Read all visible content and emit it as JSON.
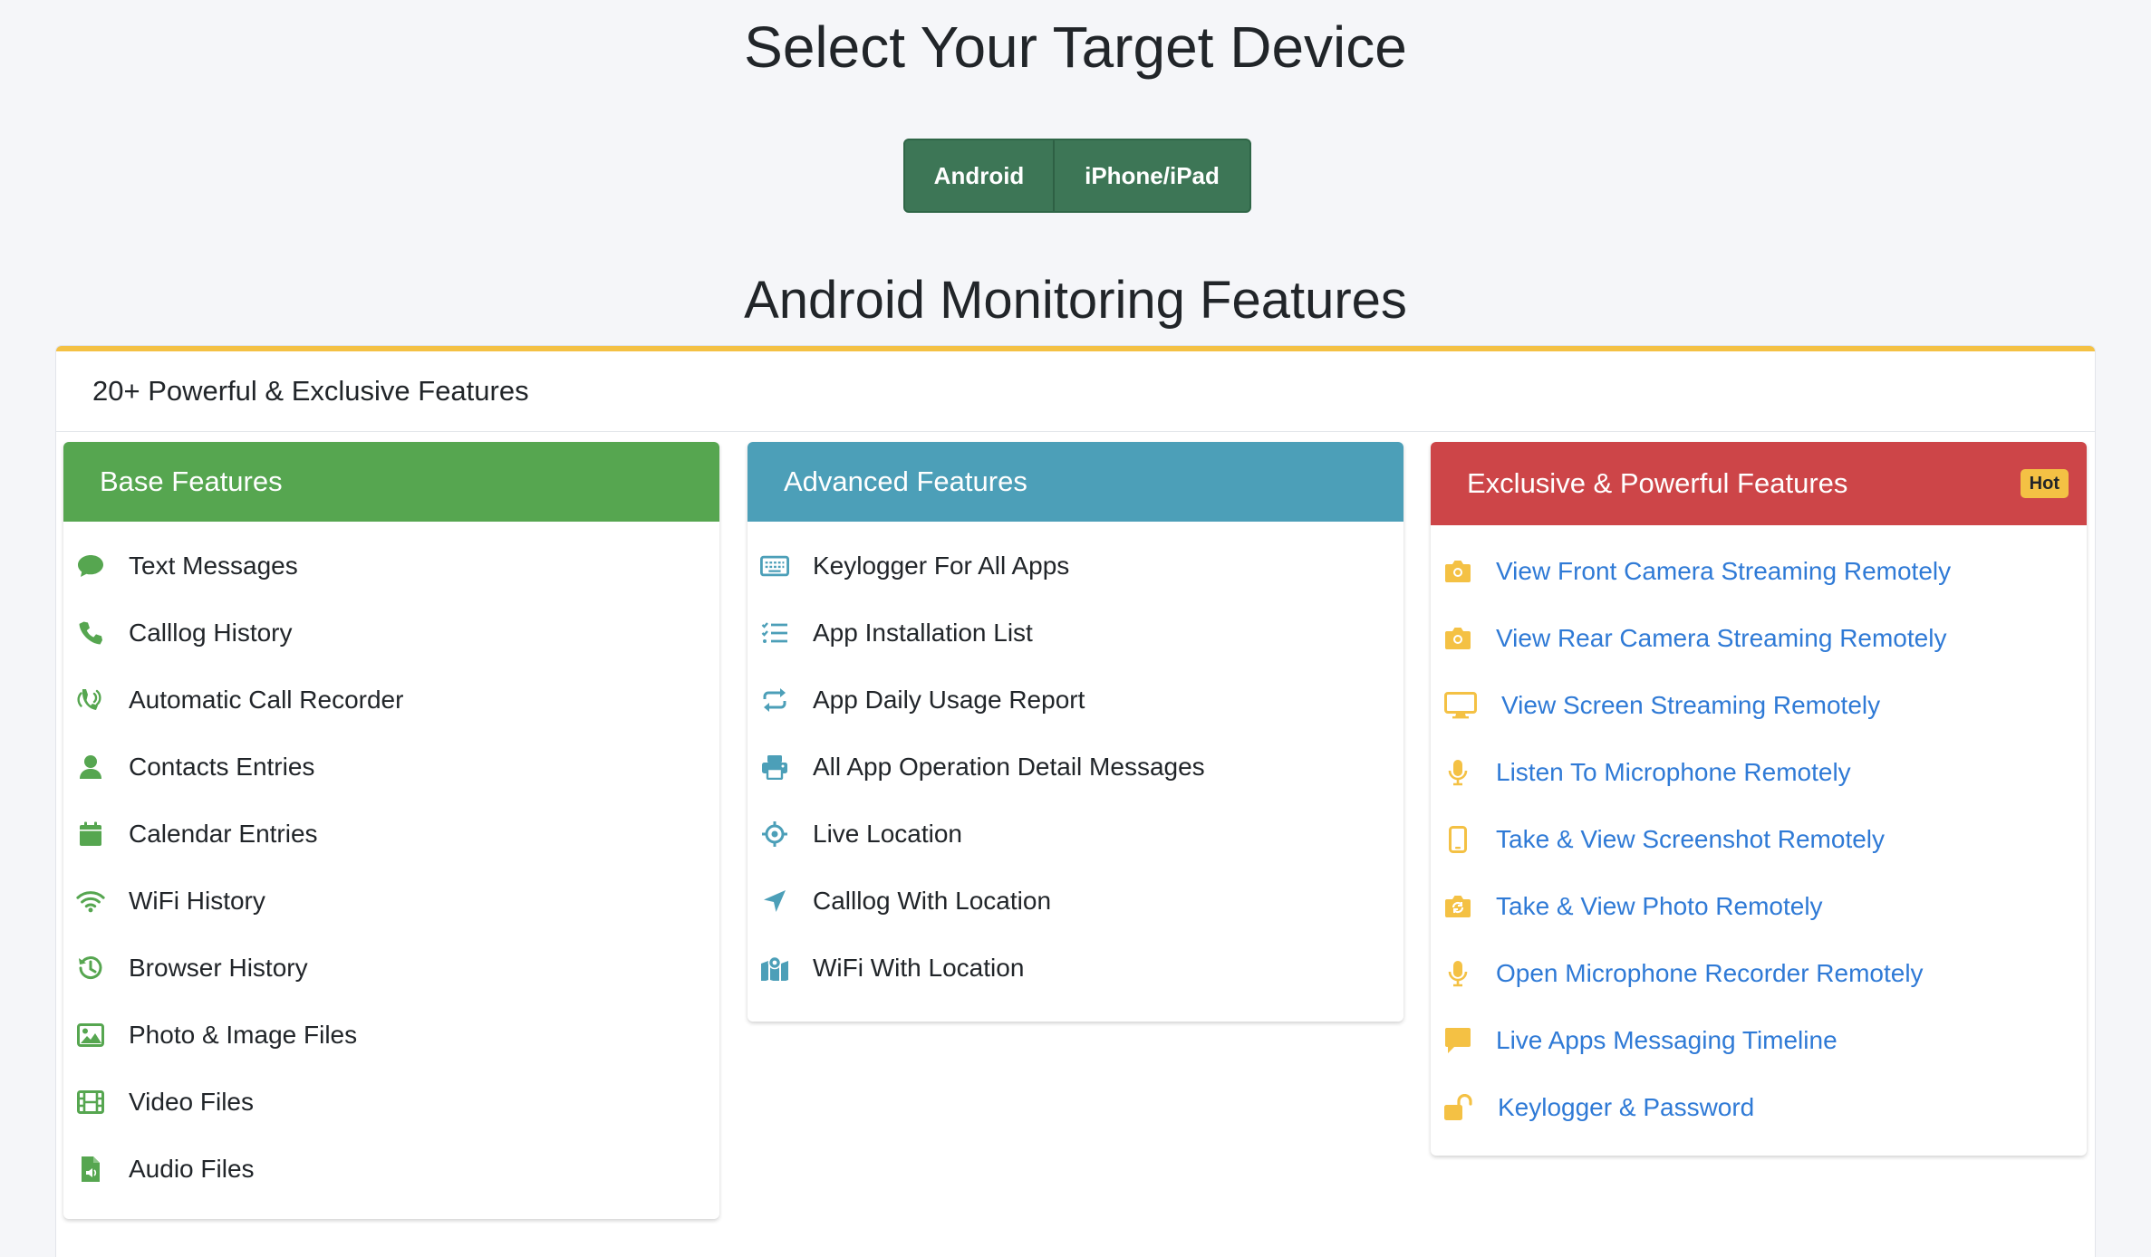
{
  "header": {
    "title": "Select Your Target Device"
  },
  "device_toggle": {
    "android_label": "Android",
    "iphone_label": "iPhone/iPad"
  },
  "section": {
    "title": "Android Monitoring Features",
    "subtitle": "20+ Powerful & Exclusive Features"
  },
  "colors": {
    "accent_yellow": "#f4c144",
    "toggle_green": "#3d7656",
    "base_green": "#56a650",
    "advanced_teal": "#4c9fb8",
    "exclusive_red": "#cd4548",
    "link_blue": "#2f7ad6"
  },
  "base": {
    "title": "Base Features",
    "items": [
      {
        "label": "Text Messages",
        "icon": "chat-bubble-icon"
      },
      {
        "label": "Calllog History",
        "icon": "phone-icon"
      },
      {
        "label": "Automatic Call Recorder",
        "icon": "phone-volume-icon"
      },
      {
        "label": "Contacts Entries",
        "icon": "user-icon"
      },
      {
        "label": "Calendar Entries",
        "icon": "calendar-icon"
      },
      {
        "label": "WiFi History",
        "icon": "wifi-icon"
      },
      {
        "label": "Browser History",
        "icon": "history-icon"
      },
      {
        "label": "Photo & Image Files",
        "icon": "image-icon"
      },
      {
        "label": "Video Files",
        "icon": "film-icon"
      },
      {
        "label": "Audio Files",
        "icon": "audio-file-icon"
      }
    ]
  },
  "advanced": {
    "title": "Advanced Features",
    "items": [
      {
        "label": "Keylogger For All Apps",
        "icon": "keyboard-icon"
      },
      {
        "label": "App Installation List",
        "icon": "checklist-icon"
      },
      {
        "label": "App Daily Usage Report",
        "icon": "repeat-icon"
      },
      {
        "label": "All App Operation Detail Messages",
        "icon": "printer-icon"
      },
      {
        "label": "Live Location",
        "icon": "crosshairs-icon"
      },
      {
        "label": "Calllog With Location",
        "icon": "location-arrow-icon"
      },
      {
        "label": "WiFi With Location",
        "icon": "map-marked-icon"
      }
    ]
  },
  "exclusive": {
    "title": "Exclusive & Powerful Features",
    "badge": "Hot",
    "items": [
      {
        "label": "View Front Camera Streaming Remotely",
        "icon": "camera-icon"
      },
      {
        "label": "View Rear Camera Streaming Remotely",
        "icon": "camera-icon"
      },
      {
        "label": "View Screen Streaming Remotely",
        "icon": "desktop-icon"
      },
      {
        "label": "Listen To Microphone Remotely",
        "icon": "microphone-icon"
      },
      {
        "label": "Take & View Screenshot Remotely",
        "icon": "mobile-icon"
      },
      {
        "label": "Take & View Photo Remotely",
        "icon": "camera-retro-icon"
      },
      {
        "label": "Open Microphone Recorder Remotely",
        "icon": "microphone-icon"
      },
      {
        "label": "Live Apps Messaging Timeline",
        "icon": "comment-icon"
      },
      {
        "label": "Keylogger & Password",
        "icon": "unlock-icon"
      }
    ]
  }
}
